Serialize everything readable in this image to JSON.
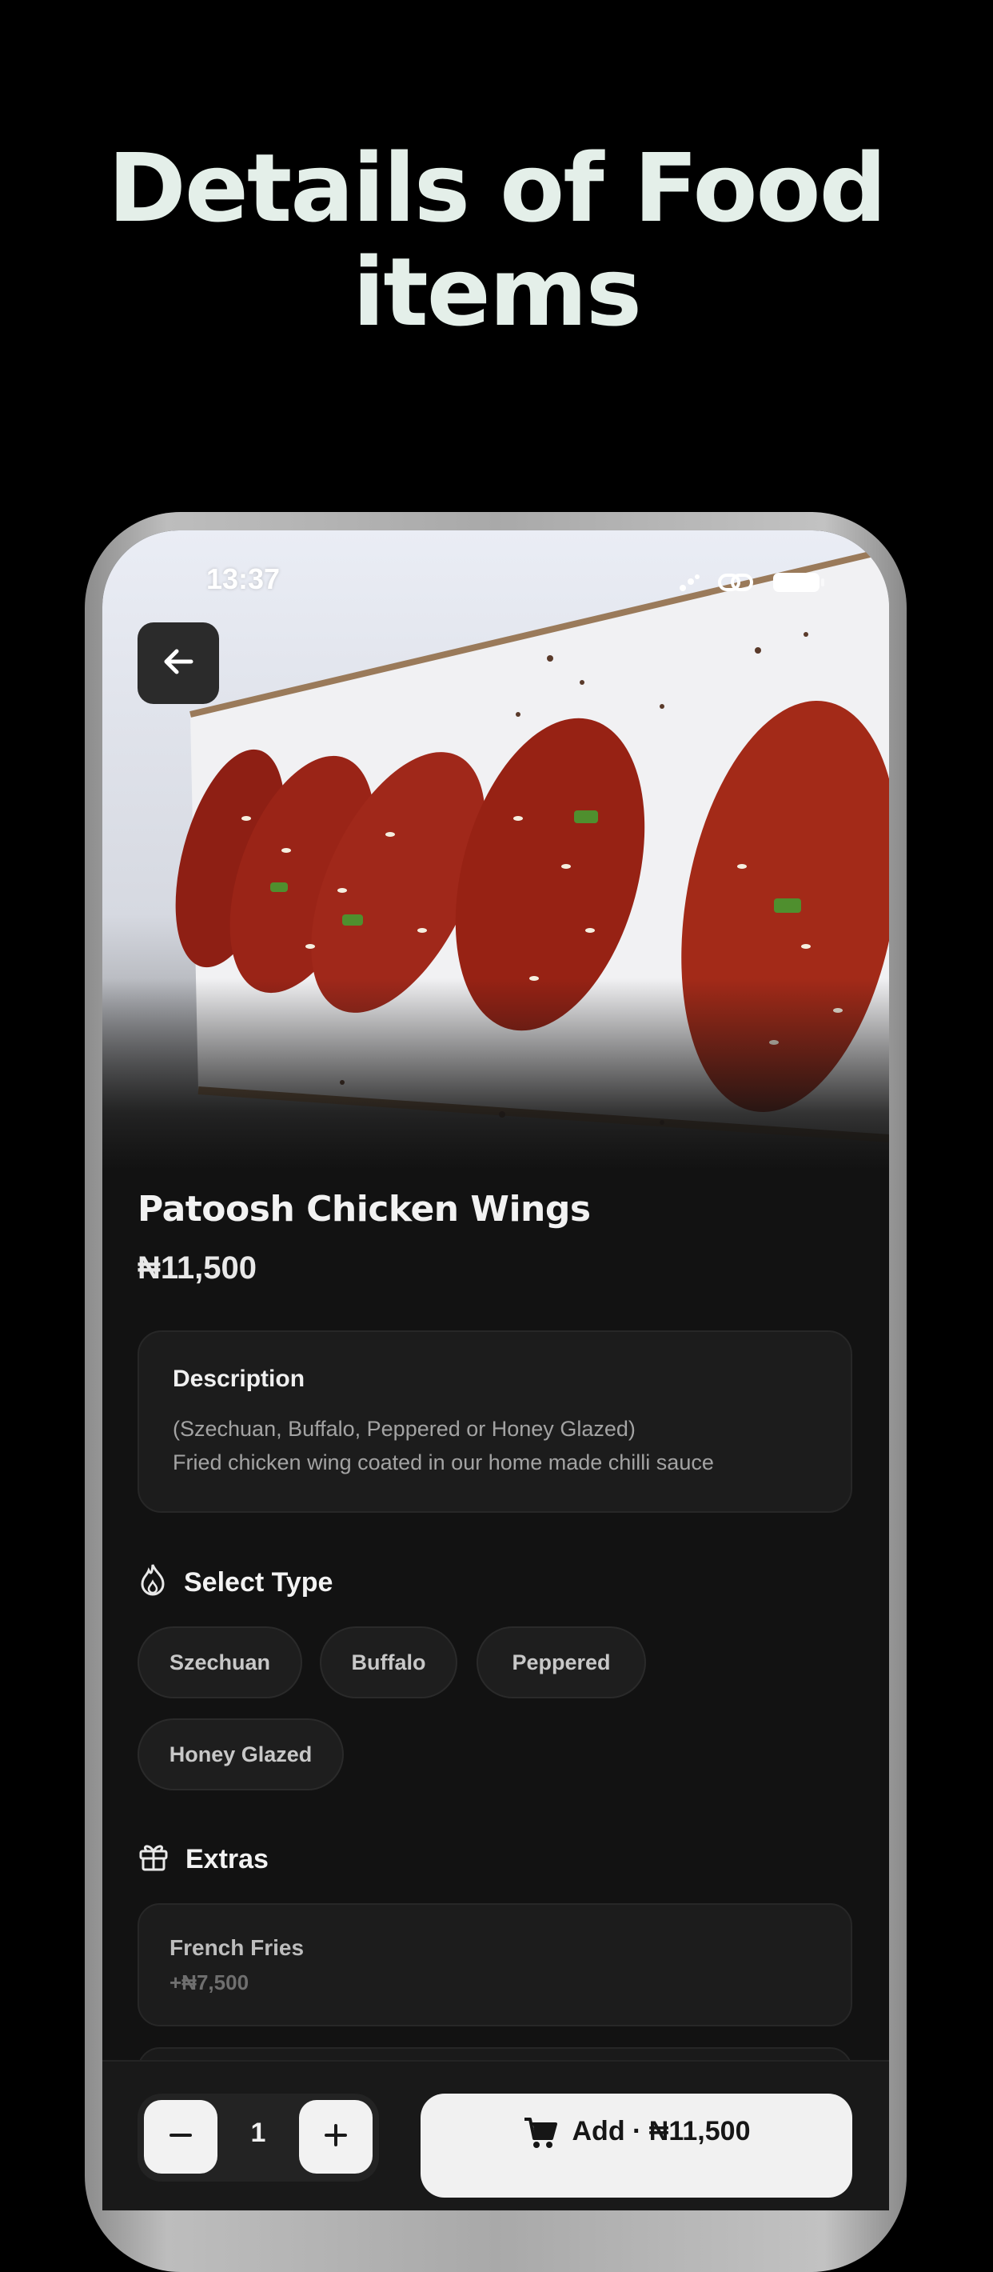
{
  "headline": {
    "line1": "Details of Food",
    "line2": "items"
  },
  "status_bar": {
    "time": "13:37",
    "icons": [
      "signal-icon",
      "link-icon",
      "battery-icon"
    ]
  },
  "hero": {
    "alt_icon": "back-arrow-icon"
  },
  "product": {
    "name": "Patoosh Chicken Wings",
    "price": "₦11,500"
  },
  "description": {
    "label": "Description",
    "line1": "(Szechuan, Buffalo, Peppered or Honey Glazed)",
    "line2": "Fried chicken wing coated in our home made chilli sauce"
  },
  "select_type": {
    "label": "Select Type",
    "icon": "flame-icon",
    "options": [
      "Szechuan",
      "Buffalo",
      "Peppered",
      "Honey Glazed"
    ]
  },
  "extras": {
    "label": "Extras",
    "icon": "gift-icon",
    "items": [
      {
        "name": "French Fries",
        "price": "+₦7,500"
      }
    ]
  },
  "cart": {
    "quantity": "1",
    "add_label": "Add · ₦11,500",
    "icon": "cart-icon"
  },
  "colors": {
    "background": "#000000",
    "headline": "#e4efe9",
    "screen": "#121212",
    "card": "#1c1c1c",
    "button_light": "#f1f1f1"
  }
}
